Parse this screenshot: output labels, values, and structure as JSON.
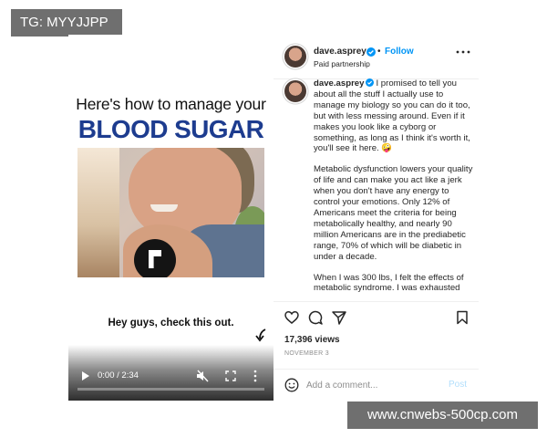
{
  "watermarks": {
    "top_left": "TG: MYYJJPP",
    "bottom_right": "www.cnwebs-500cp.com"
  },
  "video": {
    "title": "Here's how to manage your",
    "headline": "BLOOD SUGAR",
    "headline_color": "#1d3c8f",
    "caption": "Hey guys, check this out.",
    "controls": {
      "time": "0:00 / 2:34",
      "progress": 0,
      "icons": [
        "play-icon",
        "mute-icon",
        "fullscreen-icon",
        "more-vertical-icon"
      ]
    }
  },
  "post": {
    "username": "dave.asprey",
    "follow_label": "Follow",
    "separator": "•",
    "subtitle": "Paid partnership",
    "follow_color": "#0095f6",
    "caption": {
      "username": "dave.asprey",
      "p1": "I promised to tell you about all the stuff I actually use to manage my biology so you can do it too, but with less messing around. Even if it makes you look like a cyborg or something, as long as I think it's worth it, you'll see it here. 🤪",
      "p2": "Metabolic dysfunction lowers your quality of life and can make you act like a jerk when you don't have any energy to control your emotions. Only 12% of Americans meet the criteria for being metabolically healthy, and nearly 90 million Americans are in the prediabetic range, 70% of which will be diabetic in under a decade.",
      "p3": "When I was 300 lbs, I felt the effects of metabolic syndrome. I was exhausted"
    },
    "action_icons": [
      "heart-icon",
      "comment-icon",
      "share-icon",
      "bookmark-icon"
    ],
    "views": "17,396 views",
    "date": "NOVEMBER 3",
    "comment_placeholder": "Add a comment...",
    "post_label": "Post"
  }
}
